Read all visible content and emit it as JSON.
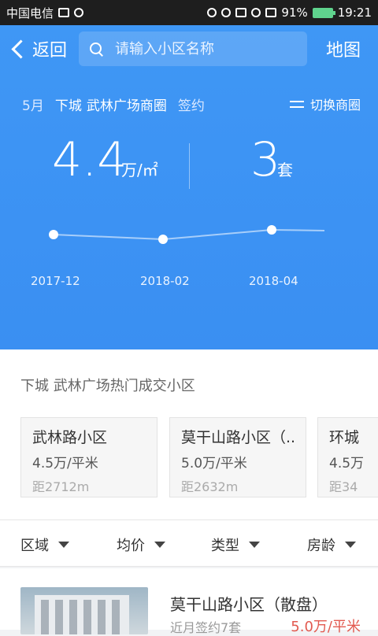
{
  "status_bar": {
    "carrier": "中国电信",
    "battery_pct": "91%",
    "time": "19:21"
  },
  "header": {
    "back_label": "返回",
    "search_placeholder": "请输入小区名称",
    "map_label": "地图"
  },
  "filter_line": {
    "month": "5月",
    "district": "下城",
    "area": "武林广场商圈",
    "type": "签约",
    "switch_label": "切换商圈"
  },
  "stats": {
    "avg_price": "4.4",
    "avg_unit": "万/㎡",
    "deals": "3",
    "deals_unit": "套"
  },
  "chart_data": {
    "type": "line",
    "x": [
      "2017-12",
      "2018-02",
      "2018-04"
    ],
    "values": [
      4.4,
      4.3,
      4.5
    ],
    "xlabel": "",
    "ylabel": ""
  },
  "section": {
    "title": "下城 武林广场热门成交小区",
    "cards": [
      {
        "name": "武林路小区",
        "price": "4.5万/平米",
        "distance": "距2712m"
      },
      {
        "name": "莫干山路小区（...",
        "price": "5.0万/平米",
        "distance": "距2632m"
      },
      {
        "name": "环城",
        "price": "4.5万",
        "distance": "距34"
      }
    ]
  },
  "filters": [
    {
      "label": "区域"
    },
    {
      "label": "均价"
    },
    {
      "label": "类型"
    },
    {
      "label": "房龄"
    }
  ],
  "listing": {
    "title": "莫干山路小区（散盘）",
    "subtitle": "近月签约7套",
    "price": "5.0万/平米"
  }
}
